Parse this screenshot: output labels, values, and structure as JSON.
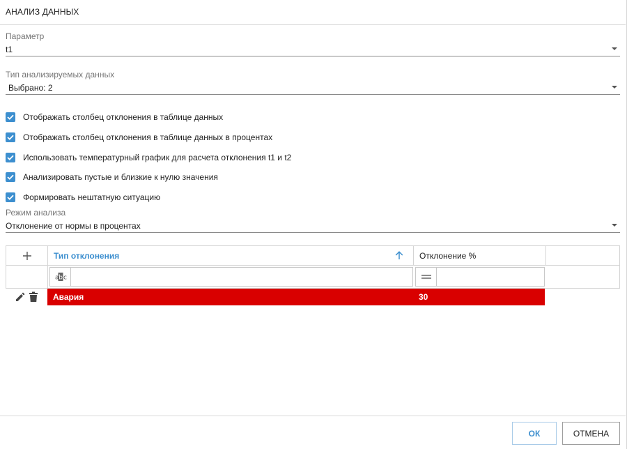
{
  "dialog": {
    "title": "АНАЛИЗ ДАННЫХ"
  },
  "parameter": {
    "label": "Параметр",
    "value": "t1"
  },
  "data_type": {
    "label": "Тип анализируемых данных",
    "value": "Выбрано: 2"
  },
  "checkboxes": [
    {
      "label": "Отображать столбец отклонения в таблице данных",
      "checked": true
    },
    {
      "label": "Отображать столбец отклонения в таблице данных в процентах",
      "checked": true
    },
    {
      "label": "Использовать температурный график для расчета отклонения t1 и t2",
      "checked": true
    },
    {
      "label": "Анализировать пустые и близкие к нулю значения",
      "checked": true
    },
    {
      "label": "Формировать нештатную ситуацию",
      "checked": true
    }
  ],
  "analysis_mode": {
    "label": "Режим анализа",
    "value": "Отклонение от нормы в процентах"
  },
  "grid": {
    "columns": {
      "type": "Тип отклонения",
      "deviation": "Отклонение %"
    },
    "filter": {
      "type_op_icon": "abc-icon",
      "dev_op_icon": "equals-icon",
      "type_value": "",
      "dev_value": ""
    },
    "rows": [
      {
        "type": "Авария",
        "deviation": "30",
        "color": "#d90000"
      }
    ]
  },
  "footer": {
    "ok": "ОК",
    "cancel": "ОТМЕНА"
  },
  "colors": {
    "accent": "#3d8fcf",
    "alarm": "#d90000"
  }
}
